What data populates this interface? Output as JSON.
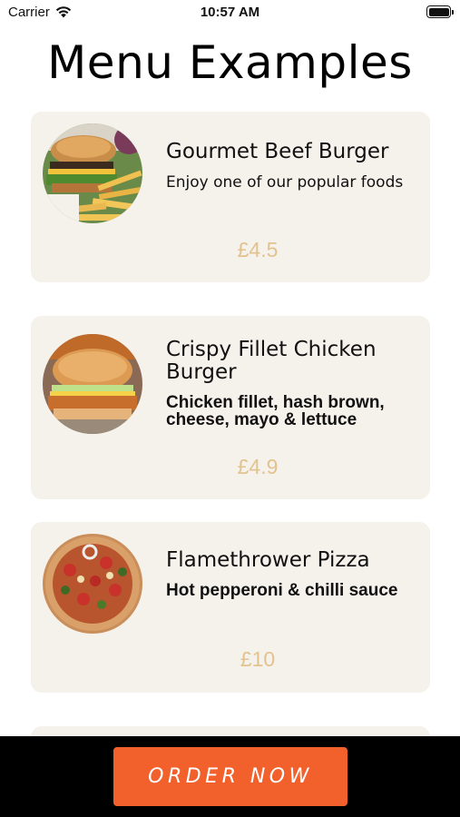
{
  "status_bar": {
    "carrier": "Carrier",
    "time": "10:57 AM",
    "icons": [
      "wifi-icon",
      "battery-icon"
    ]
  },
  "page": {
    "title": "Menu Examples"
  },
  "menu": {
    "items": [
      {
        "name": "Gourmet Beef Burger",
        "description": "Enjoy one of our popular foods",
        "price": "£4.5",
        "image": "beef-burger-photo"
      },
      {
        "name": "Crispy Fillet Chicken Burger",
        "description": "Chicken fillet, hash brown, cheese, mayo & lettuce",
        "price": "£4.9",
        "image": "chicken-burger-photo"
      },
      {
        "name": "Flamethrower Pizza",
        "description": "Hot pepperoni & chilli sauce",
        "price": "£10",
        "image": "pizza-photo"
      }
    ]
  },
  "footer": {
    "order_label": "ORDER NOW"
  },
  "colors": {
    "card_background": "#f5f1eb",
    "price": "#e3c28f",
    "order_button": "#f2602b",
    "footer_background": "#000000"
  }
}
